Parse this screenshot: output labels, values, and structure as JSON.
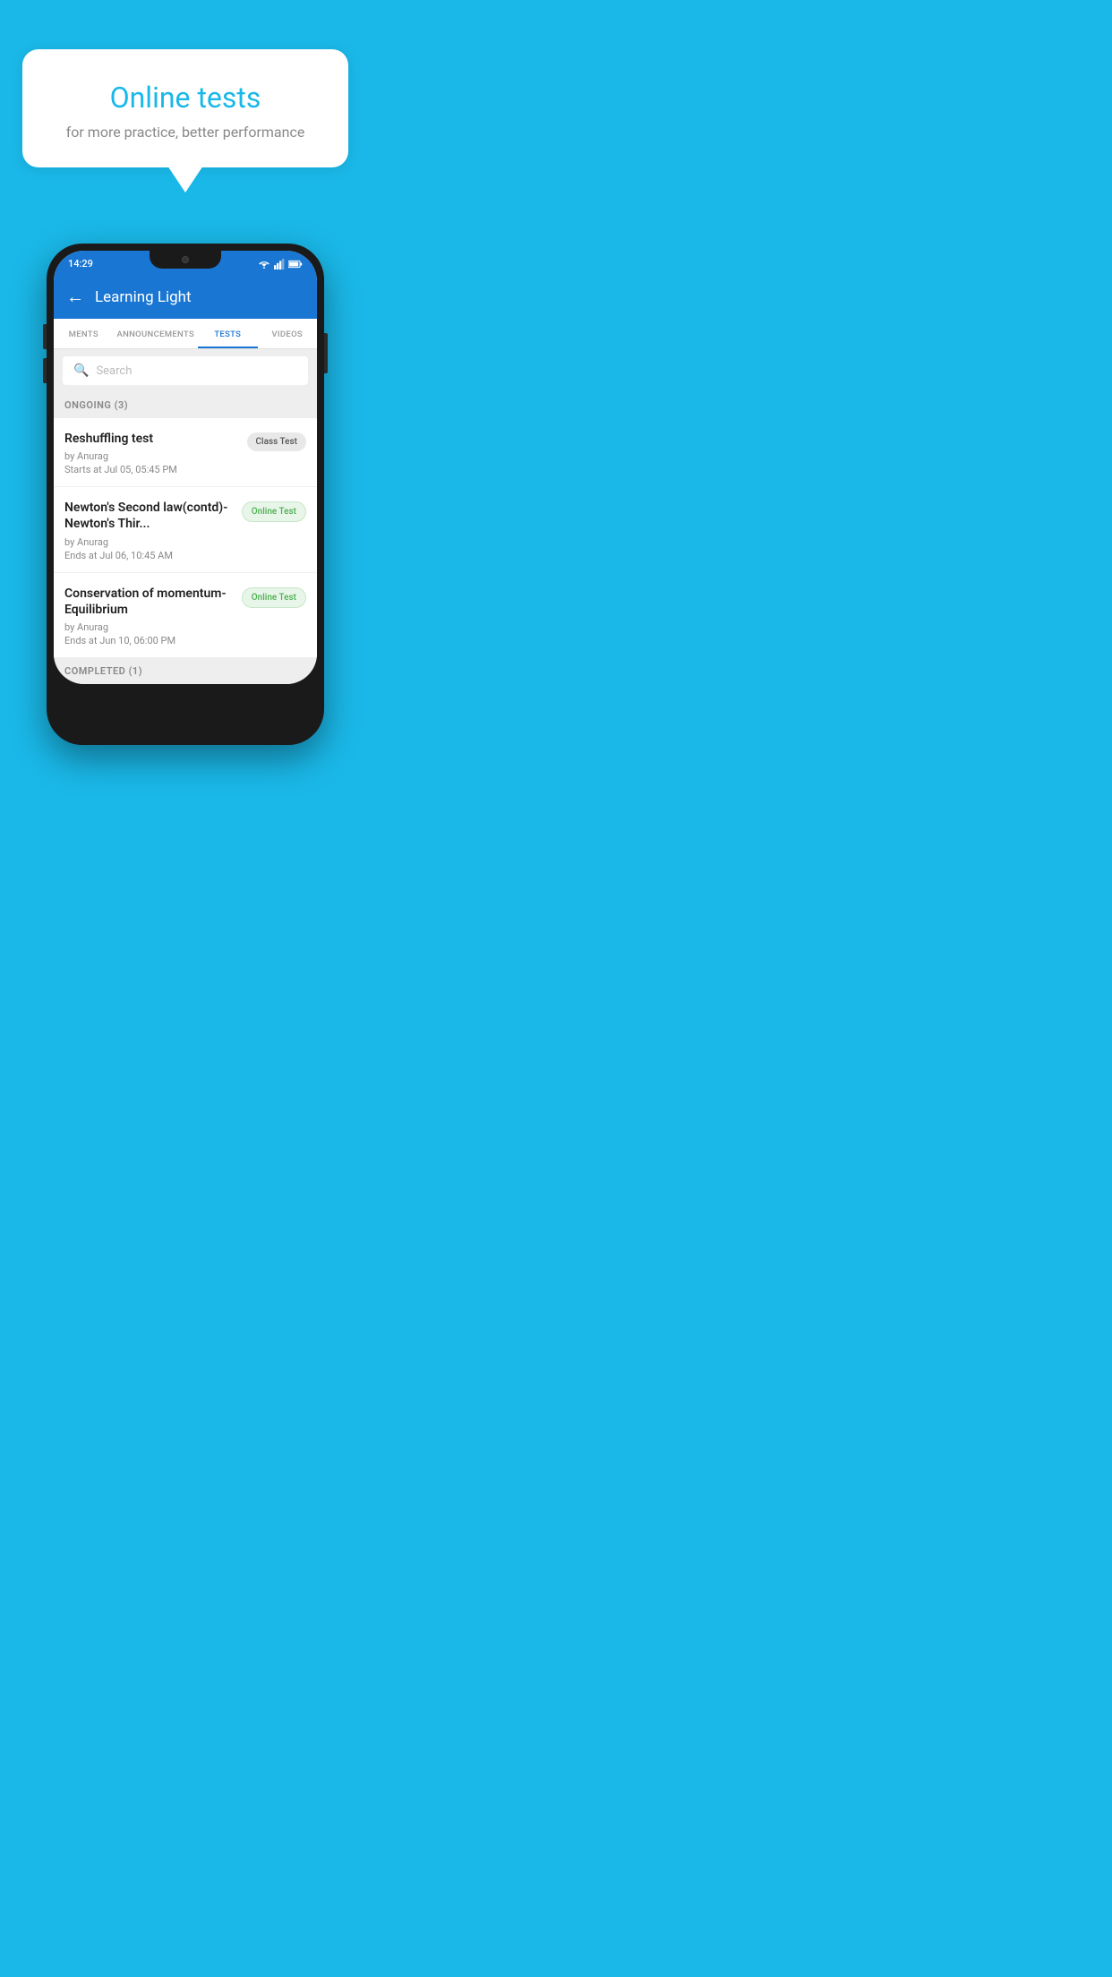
{
  "background_color": "#1ab8e8",
  "speech_bubble": {
    "title": "Online tests",
    "subtitle": "for more practice, better performance"
  },
  "phone": {
    "status_bar": {
      "time": "14:29"
    },
    "app_bar": {
      "title": "Learning Light",
      "back_label": "←"
    },
    "tabs": [
      {
        "label": "MENTS",
        "active": false
      },
      {
        "label": "ANNOUNCEMENTS",
        "active": false
      },
      {
        "label": "TESTS",
        "active": true
      },
      {
        "label": "VIDEOS",
        "active": false
      }
    ],
    "search": {
      "placeholder": "Search"
    },
    "ongoing_section": {
      "label": "ONGOING (3)"
    },
    "tests": [
      {
        "title": "Reshuffling test",
        "author": "by Anurag",
        "date": "Starts at  Jul 05, 05:45 PM",
        "badge": "Class Test",
        "badge_type": "class"
      },
      {
        "title": "Newton's Second law(contd)-Newton's Thir...",
        "author": "by Anurag",
        "date": "Ends at  Jul 06, 10:45 AM",
        "badge": "Online Test",
        "badge_type": "online"
      },
      {
        "title": "Conservation of momentum-Equilibrium",
        "author": "by Anurag",
        "date": "Ends at  Jun 10, 06:00 PM",
        "badge": "Online Test",
        "badge_type": "online"
      }
    ],
    "completed_section": {
      "label": "COMPLETED (1)"
    }
  }
}
